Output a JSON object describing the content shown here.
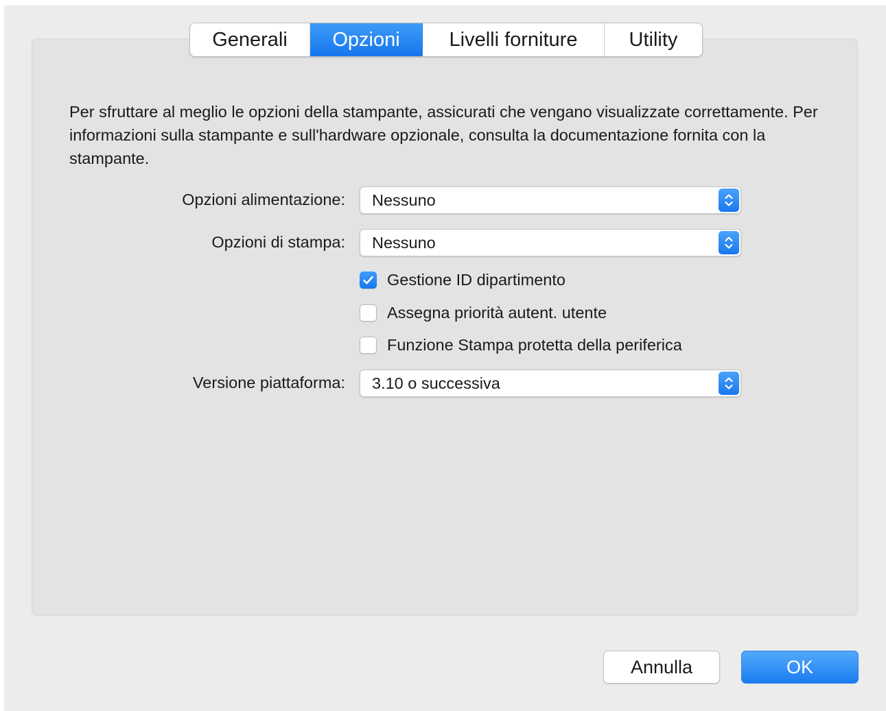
{
  "tabs": [
    {
      "label": "Generali",
      "active": false
    },
    {
      "label": "Opzioni",
      "active": true
    },
    {
      "label": "Livelli forniture",
      "active": false
    },
    {
      "label": "Utility",
      "active": false
    }
  ],
  "description": "Per sfruttare al meglio le opzioni della stampante, assicurati che vengano visualizzate correttamente. Per informazioni sulla stampante e sull'hardware opzionale, consulta la documentazione fornita con la stampante.",
  "fields": {
    "alimentazione": {
      "label": "Opzioni alimentazione:",
      "value": "Nessuno"
    },
    "stampa": {
      "label": "Opzioni di stampa:",
      "value": "Nessuno"
    },
    "piattaforma": {
      "label": "Versione piattaforma:",
      "value": "3.10 o successiva"
    }
  },
  "checkboxes": [
    {
      "label": "Gestione ID dipartimento",
      "checked": true
    },
    {
      "label": "Assegna priorità autent. utente",
      "checked": false
    },
    {
      "label": "Funzione Stampa protetta della periferica",
      "checked": false
    }
  ],
  "buttons": {
    "cancel": "Annulla",
    "ok": "OK"
  },
  "colors": {
    "accent": "#1676ee",
    "window_bg": "#ececec",
    "panel_bg": "#e3e3e3"
  },
  "icons": {
    "popup_arrows": "up-down-chevron-icon",
    "checkmark": "checkmark-icon"
  }
}
